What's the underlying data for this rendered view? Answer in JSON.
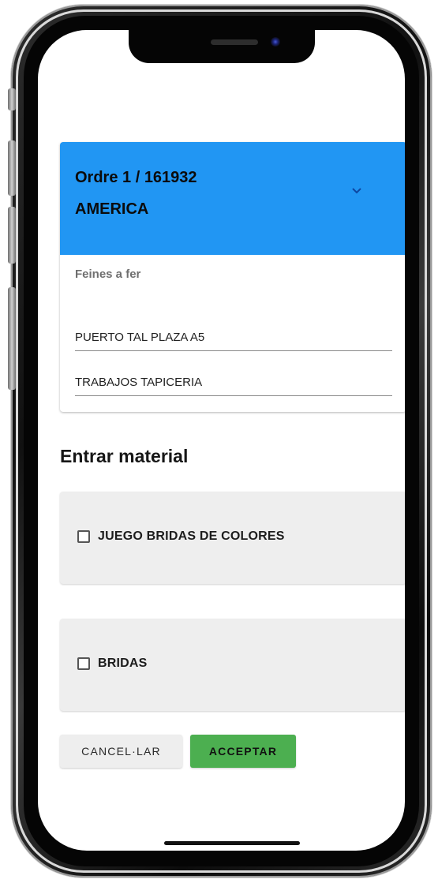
{
  "order": {
    "title": "Ordre 1 / 161932",
    "client": "AMERICA",
    "chevron_icon": "chevron-down-icon",
    "header_color": "#2196f3"
  },
  "tasks": {
    "label": "Feines a fer",
    "items": [
      {
        "text": "PUERTO TAL PLAZA A5"
      },
      {
        "text": "TRABAJOS TAPICERIA"
      }
    ]
  },
  "materials": {
    "title": "Entrar material",
    "items": [
      {
        "label": "JUEGO BRIDAS DE COLORES",
        "checked": false
      },
      {
        "label": "BRIDAS",
        "checked": false
      }
    ]
  },
  "actions": {
    "cancel_label": "CANCEL·LAR",
    "accept_label": "ACCEPTAR",
    "accept_color": "#4caf50"
  }
}
